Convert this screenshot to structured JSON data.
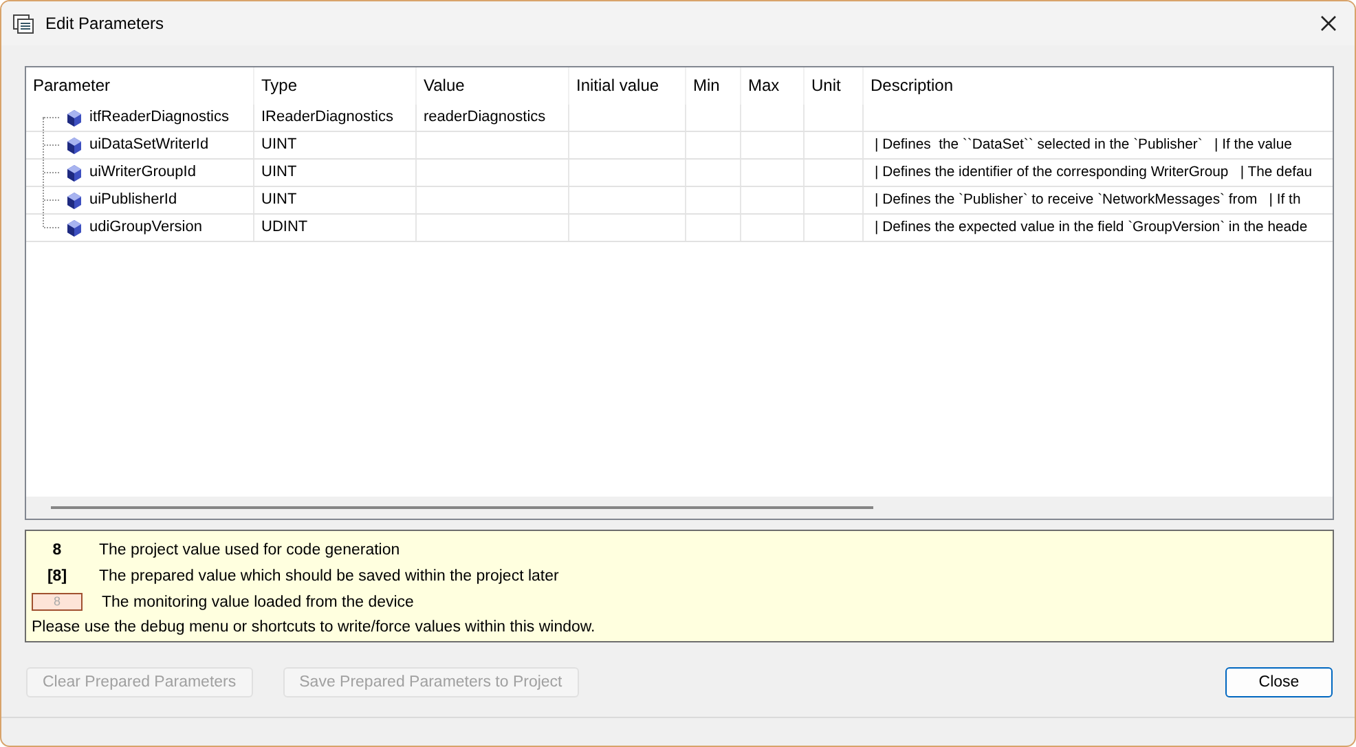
{
  "window": {
    "title": "Edit Parameters"
  },
  "table": {
    "columns": [
      "Parameter",
      "Type",
      "Value",
      "Initial value",
      "Min",
      "Max",
      "Unit",
      "Description"
    ],
    "rows": [
      {
        "parameter": "itfReaderDiagnostics",
        "type": "IReaderDiagnostics",
        "value": "readerDiagnostics",
        "description": ""
      },
      {
        "parameter": "uiDataSetWriterId",
        "type": "UINT",
        "value": "",
        "description": "| Defines  the ``DataSet`` selected in the `Publisher`   | If the value"
      },
      {
        "parameter": "uiWriterGroupId",
        "type": "UINT",
        "value": "",
        "description": "| Defines the identifier of the corresponding WriterGroup   | The defau"
      },
      {
        "parameter": "uiPublisherId",
        "type": "UINT",
        "value": "",
        "description": "| Defines the `Publisher` to receive `NetworkMessages` from   | If th"
      },
      {
        "parameter": "udiGroupVersion",
        "type": "UDINT",
        "value": "",
        "description": "| Defines the expected value in the field `GroupVersion` in the heade"
      }
    ]
  },
  "legend": {
    "items": [
      {
        "kind": "project",
        "sample": "8",
        "text": "The project value used for code generation"
      },
      {
        "kind": "prepared",
        "sample": "[8]",
        "text": "The prepared value which should be saved within the project later"
      },
      {
        "kind": "monitoring",
        "sample": "8",
        "text": "The monitoring value loaded from the device"
      }
    ],
    "note": "Please use the debug menu or shortcuts to write/force values within this window."
  },
  "buttons": [
    {
      "label": "Clear Prepared Parameters",
      "disabled": true,
      "default": false
    },
    {
      "label": "Save Prepared Parameters to Project",
      "disabled": true,
      "default": false
    },
    {
      "label": "Close",
      "disabled": false,
      "default": true
    }
  ]
}
